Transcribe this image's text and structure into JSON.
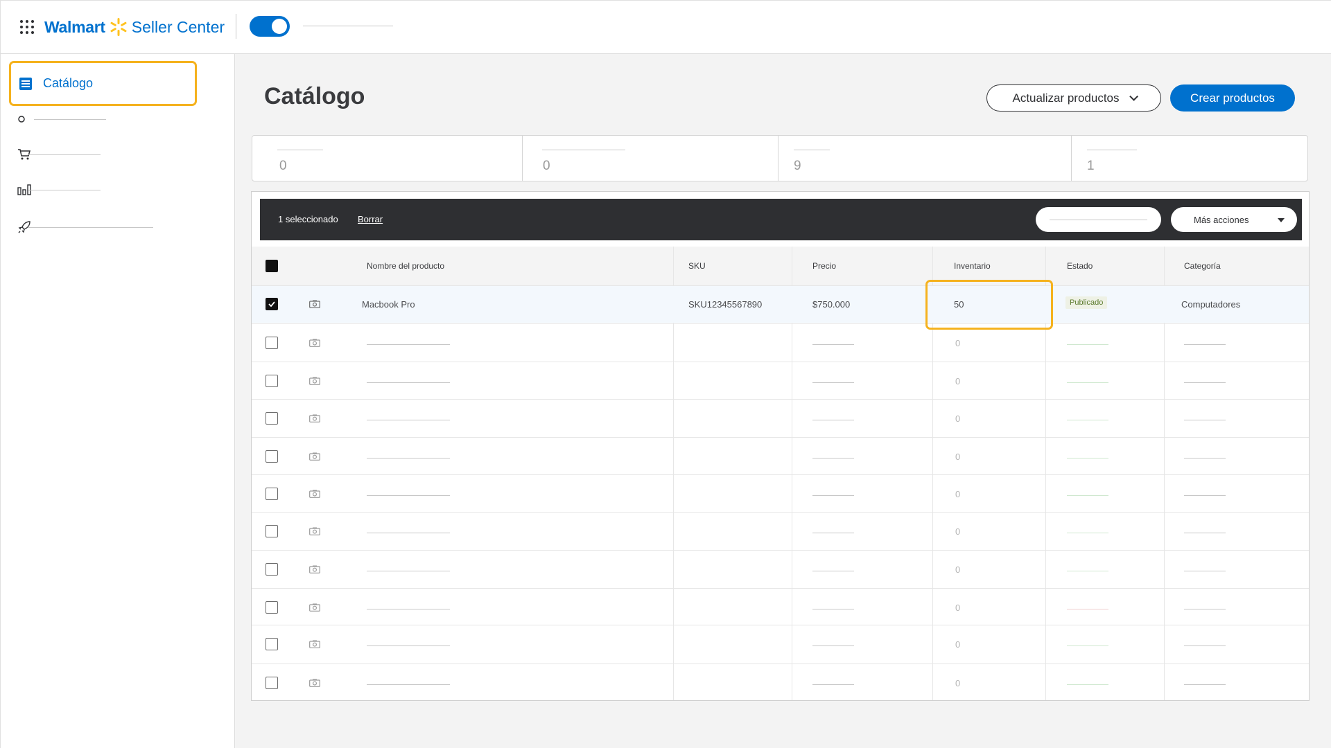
{
  "header": {
    "brand_name": "Walmart",
    "brand_product": "Seller Center",
    "toggle_on": true
  },
  "sidebar": {
    "active_item": {
      "label": "Catálogo",
      "icon": "list-icon"
    },
    "items": [
      {
        "icon": "circle-icon"
      },
      {
        "icon": "cart-icon"
      },
      {
        "icon": "bar-chart-icon"
      },
      {
        "icon": "rocket-icon"
      }
    ]
  },
  "page": {
    "title": "Catálogo",
    "update_button": "Actualizar productos",
    "create_button": "Crear productos"
  },
  "stats": [
    "0",
    "0",
    "9",
    "1"
  ],
  "selection_bar": {
    "count_text": "1 seleccionado",
    "clear_label": "Borrar",
    "more_actions": "Más acciones"
  },
  "table": {
    "columns": [
      "Nombre del producto",
      "SKU",
      "Precio",
      "Inventario",
      "Estado",
      "Categoría"
    ],
    "selected_row": {
      "checked": true,
      "name": "Macbook Pro",
      "sku": "SKU12345567890",
      "price": "$750.000",
      "inventory": "50",
      "status": "Publicado",
      "category": "Computadores"
    },
    "placeholder_rows": [
      {
        "inventory": "0"
      },
      {
        "inventory": "0"
      },
      {
        "inventory": "0"
      },
      {
        "inventory": "0"
      },
      {
        "inventory": "0"
      },
      {
        "inventory": "0"
      },
      {
        "inventory": "0"
      },
      {
        "inventory": "0"
      },
      {
        "inventory": "0"
      },
      {
        "inventory": "0"
      }
    ]
  },
  "colors": {
    "brand_blue": "#0071ce",
    "highlight": "#f5b21e",
    "spark_yellow": "#ffc220",
    "selection_bar": "#2e2f32"
  }
}
